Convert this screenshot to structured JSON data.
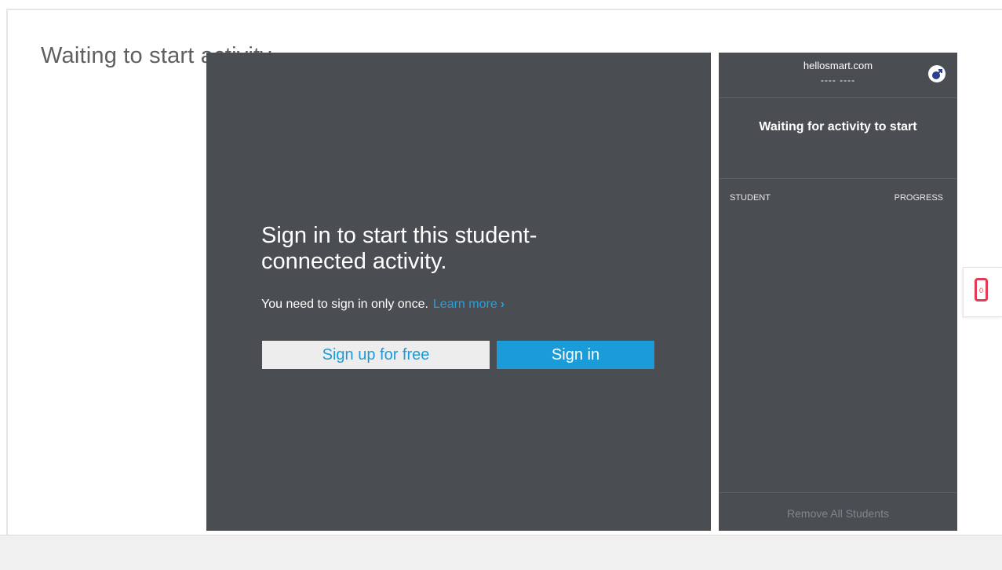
{
  "page": {
    "waiting_title": "Waiting to start activity..."
  },
  "signin": {
    "heading": "Sign in to start this student-connected activity.",
    "subtitle": "You need to sign in only once.",
    "learn_more": "Learn more",
    "learn_more_chevron": "›",
    "signup_label": "Sign up for free",
    "signin_label": "Sign in"
  },
  "side_panel": {
    "domain": "hellosmart.com",
    "code": "---- ----",
    "waiting_text": "Waiting for activity to start",
    "col_student": "STUDENT",
    "col_progress": "PROGRESS",
    "remove_all": "Remove All Students",
    "icon": "launch-icon"
  },
  "device_tab": {
    "icon": "device-icon",
    "count": "0"
  },
  "colors": {
    "panel_bg": "#4a4e52",
    "accent": "#1b9bd8",
    "device_accent": "#e23b57"
  }
}
